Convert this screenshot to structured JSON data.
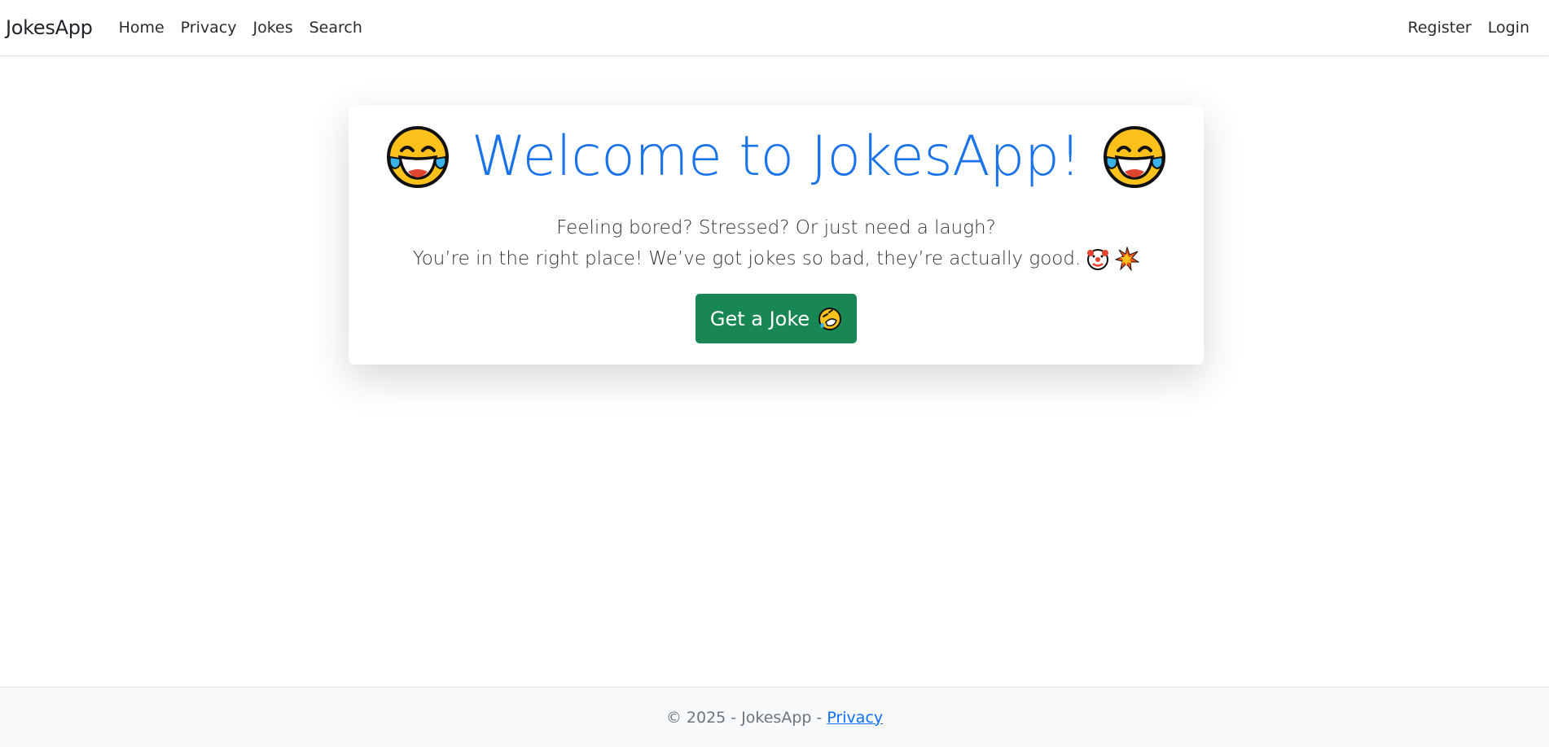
{
  "nav": {
    "brand": "JokesApp",
    "links": [
      "Home",
      "Privacy",
      "Jokes",
      "Search"
    ],
    "right_links": [
      "Register",
      "Login"
    ]
  },
  "hero": {
    "title": "Welcome to JokesApp!",
    "left_icon": "face-with-tears-of-joy",
    "right_icon": "face-with-tears-of-joy",
    "line1": "Feeling bored? Stressed? Or just need a laugh?",
    "line2": "You’re in the right place! We’ve got jokes so bad, they’re actually good.",
    "line2_icons": [
      "clown-face",
      "collision"
    ],
    "button_label": "Get a Joke",
    "button_icon": "rolling-on-floor-laughing",
    "title_color": "#1a73e8",
    "button_color": "#198754"
  },
  "footer": {
    "text": "© 2025 - JokesApp -",
    "link": "Privacy"
  }
}
